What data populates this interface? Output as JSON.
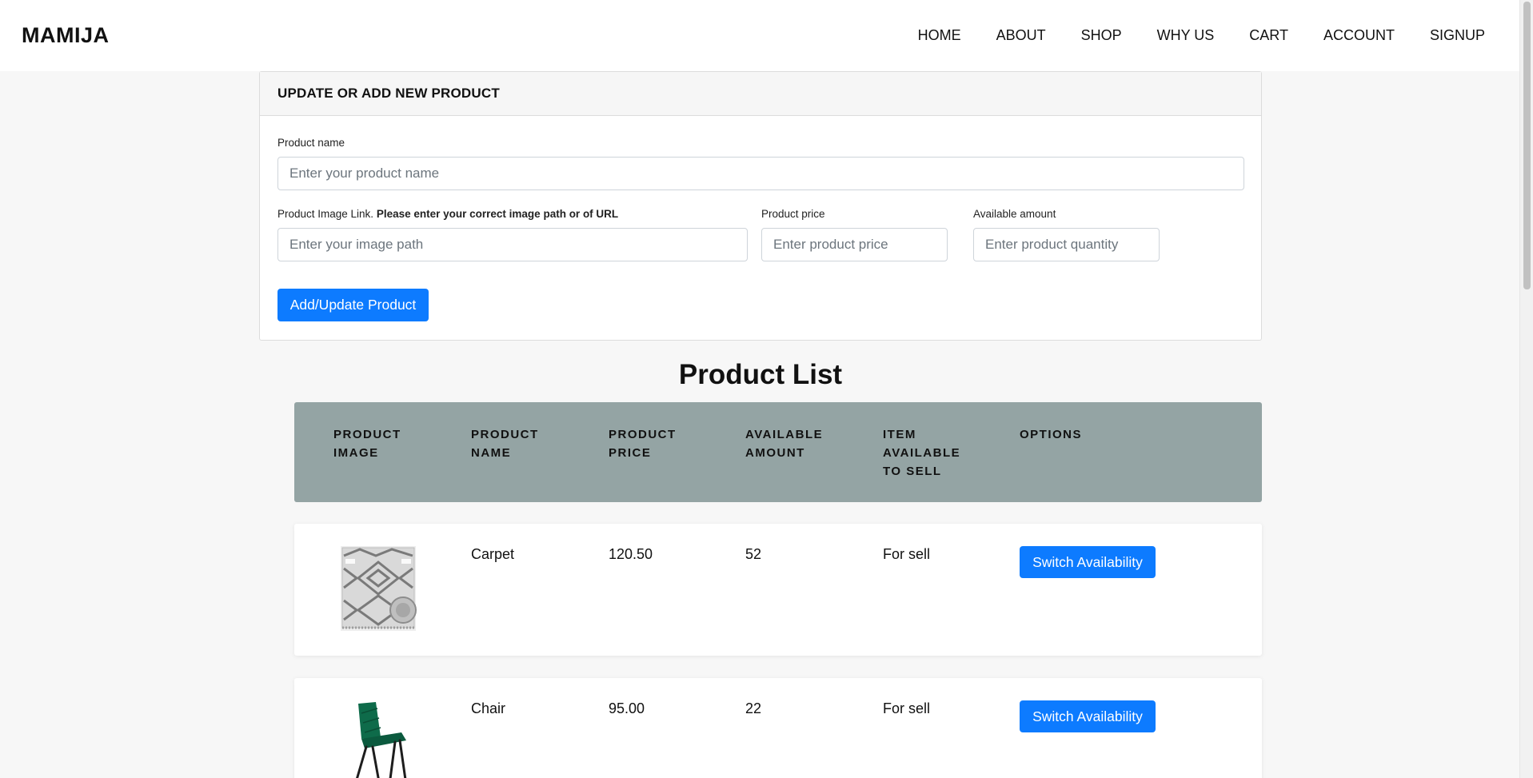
{
  "brand": "MAMIJA",
  "nav": [
    "HOME",
    "ABOUT",
    "SHOP",
    "WHY US",
    "CART",
    "ACCOUNT",
    "SIGNUP"
  ],
  "form": {
    "title": "UPDATE OR ADD NEW PRODUCT",
    "name_label": "Product name",
    "name_placeholder": "Enter your product name",
    "image_label": "Product Image Link.",
    "image_label_note": "Please enter your correct image path or of URL",
    "image_placeholder": "Enter your image path",
    "price_label": "Product price",
    "price_placeholder": "Enter product price",
    "amount_label": "Available amount",
    "amount_placeholder": "Enter product quantity",
    "submit_label": "Add/Update Product"
  },
  "list": {
    "title": "Product List",
    "headers": {
      "image": "PRODUCT IMAGE",
      "name": "PRODUCT NAME",
      "price": "PRODUCT PRICE",
      "amount": "AVAILABLE AMOUNT",
      "available": "ITEM AVAILABLE TO SELL",
      "options": "OPTIONS"
    },
    "rows": [
      {
        "name": "Carpet",
        "price": "120.50",
        "amount": "52",
        "status": "For sell",
        "action": "Switch Availability",
        "image_icon": "carpet-image"
      },
      {
        "name": "Chair",
        "price": "95.00",
        "amount": "22",
        "status": "For sell",
        "action": "Switch Availability",
        "image_icon": "chair-image"
      }
    ]
  },
  "colors": {
    "primary": "#0d7bff",
    "table_header": "#94a4a4",
    "chair_green": "#0e6b4a"
  }
}
